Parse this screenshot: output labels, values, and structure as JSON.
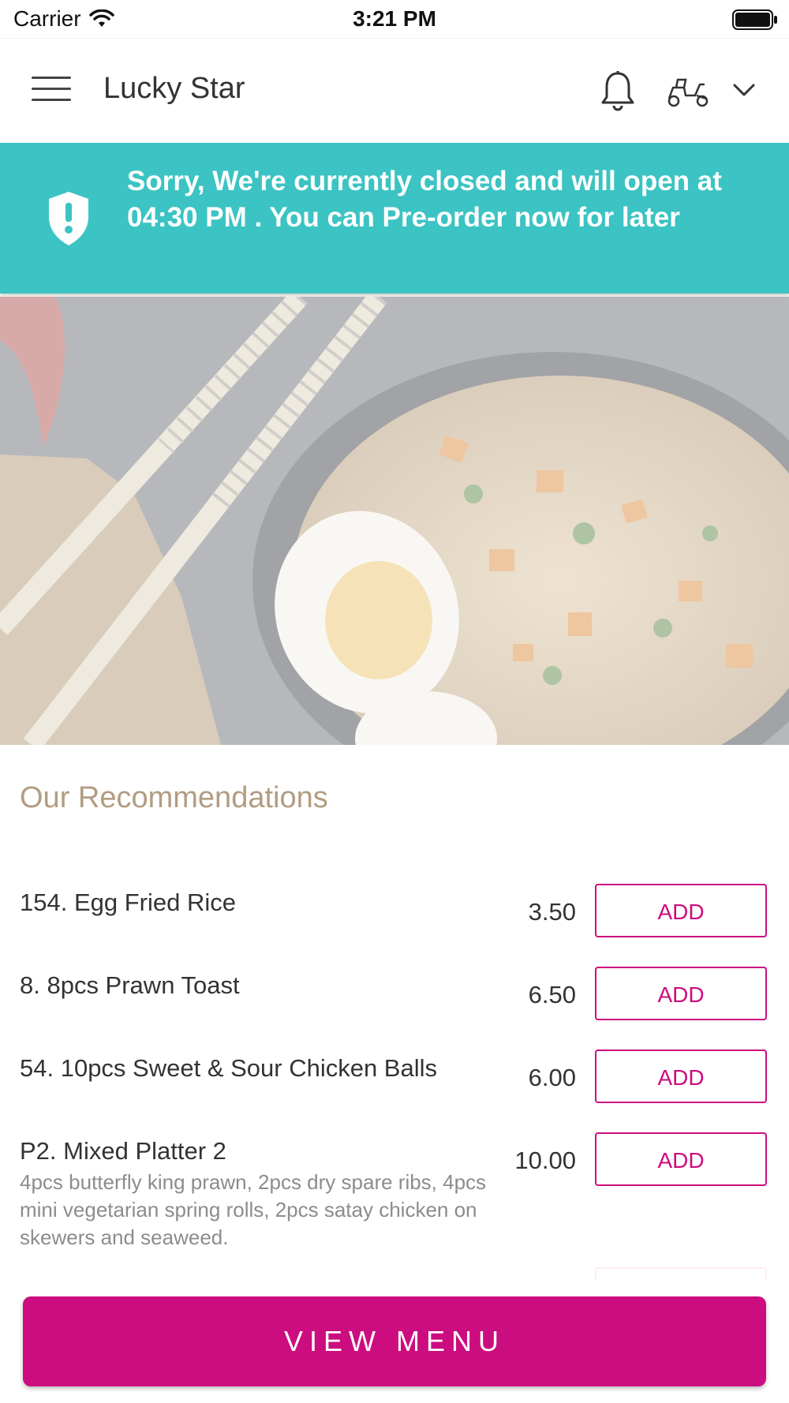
{
  "status_bar": {
    "carrier": "Carrier",
    "time": "3:21 PM"
  },
  "header": {
    "title": "Lucky Star"
  },
  "banner": {
    "message": "Sorry, We're currently closed and will open at 04:30 PM . You can Pre-order now for later"
  },
  "recommendations": {
    "title": "Our Recommendations",
    "items": [
      {
        "name": "154. Egg Fried Rice",
        "price": "3.50",
        "add_label": "ADD",
        "description": ""
      },
      {
        "name": "8. 8pcs Prawn Toast",
        "price": "6.50",
        "add_label": "ADD",
        "description": ""
      },
      {
        "name": "54. 10pcs Sweet & Sour Chicken Balls",
        "price": "6.00",
        "add_label": "ADD",
        "description": ""
      },
      {
        "name": "P2.  Mixed Platter 2",
        "price": "10.00",
        "add_label": "ADD",
        "description": "4pcs butterfly king prawn, 2pcs dry spare ribs, 4pcs mini vegetarian spring rolls, 2pcs satay chicken on skewers and seaweed."
      }
    ]
  },
  "footer": {
    "view_menu_label": "VIEW MENU"
  },
  "colors": {
    "accent": "#cc0d7f",
    "banner": "#3cc3c3",
    "section_title": "#b29c81"
  }
}
